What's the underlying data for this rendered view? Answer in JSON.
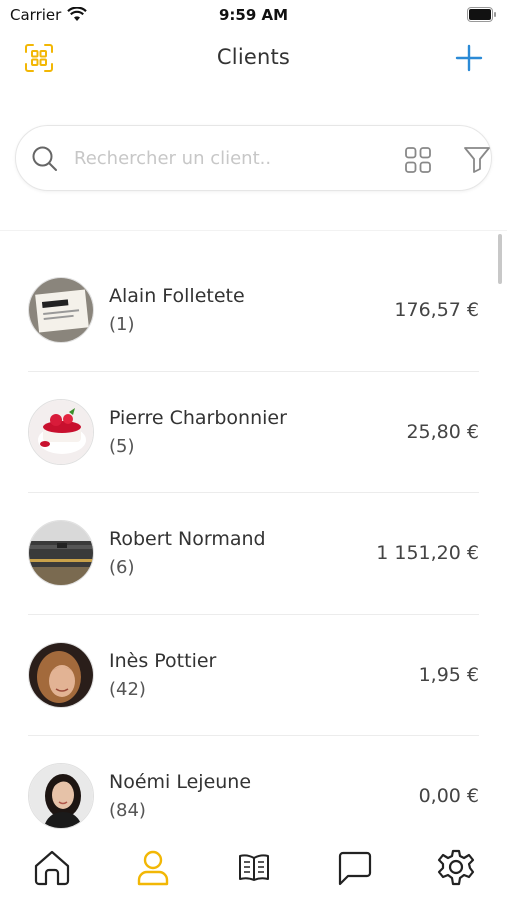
{
  "status_bar": {
    "carrier": "Carrier",
    "time": "9:59 AM"
  },
  "nav": {
    "title": "Clients",
    "accent_color": "#f2b705",
    "add_color": "#2b8ad6"
  },
  "search": {
    "placeholder": "Rechercher un client.."
  },
  "clients": [
    {
      "name": "Alain Folletete",
      "count": "(1)",
      "amount": "176,57 €",
      "avatar": "note-photo"
    },
    {
      "name": "Pierre Charbonnier",
      "count": "(5)",
      "amount": "25,80 €",
      "avatar": "dessert-photo"
    },
    {
      "name": "Robert Normand",
      "count": "(6)",
      "amount": "1 151,20 €",
      "avatar": "laptop-photo"
    },
    {
      "name": "Inès Pottier",
      "count": "(42)",
      "amount": "1,95 €",
      "avatar": "woman-photo"
    },
    {
      "name": "Noémi Lejeune",
      "count": "(84)",
      "amount": "0,00 €",
      "avatar": "woman-portrait-photo"
    }
  ],
  "tabbar": {
    "items": [
      "home-icon",
      "user-icon",
      "book-icon",
      "chat-icon",
      "gear-icon"
    ],
    "active": "user-icon"
  }
}
